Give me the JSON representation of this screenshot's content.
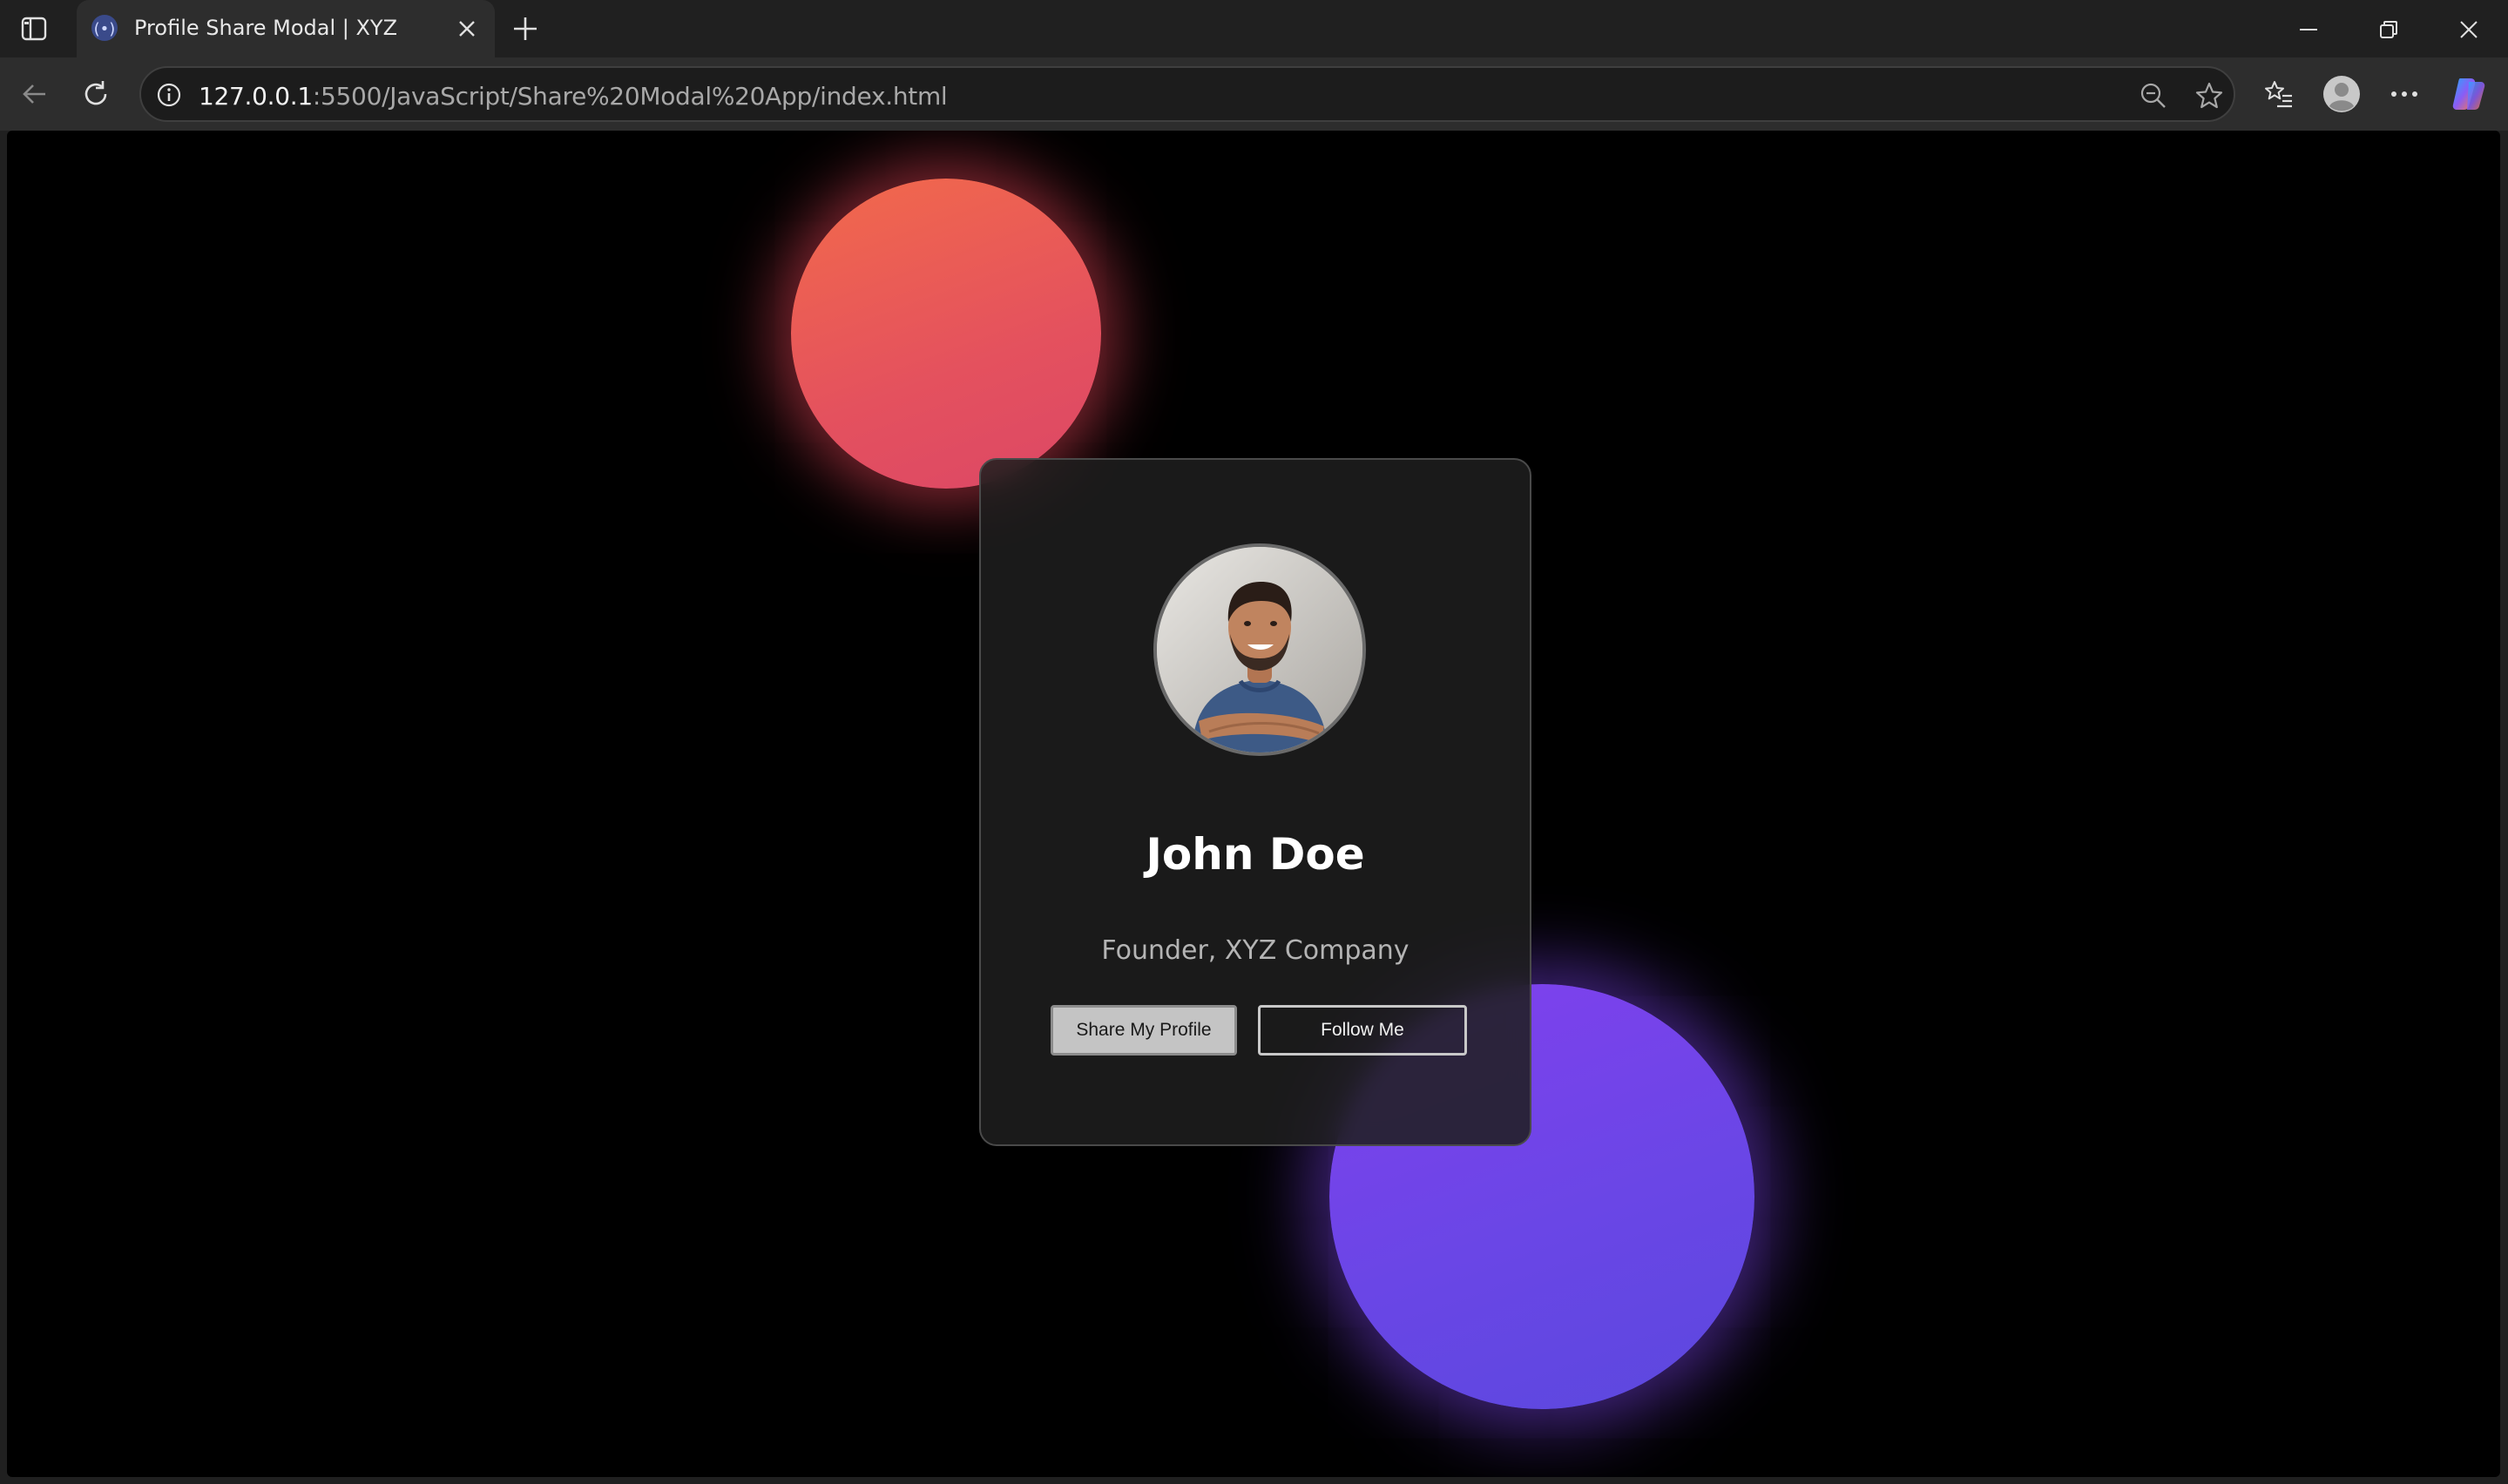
{
  "browser": {
    "tab_title": "Profile Share Modal | XYZ",
    "url_host": "127.0.0.1",
    "url_rest": ":5500/JavaScript/Share%20Modal%20App/index.html"
  },
  "profile": {
    "name": "John Doe",
    "role": "Founder, XYZ Company",
    "share_label": "Share My Profile",
    "follow_label": "Follow Me"
  },
  "colors": {
    "orb_red": "#e4515e",
    "orb_purple": "#6a46e6",
    "page_background": "#000000",
    "card_background": "#1e1e1e"
  }
}
